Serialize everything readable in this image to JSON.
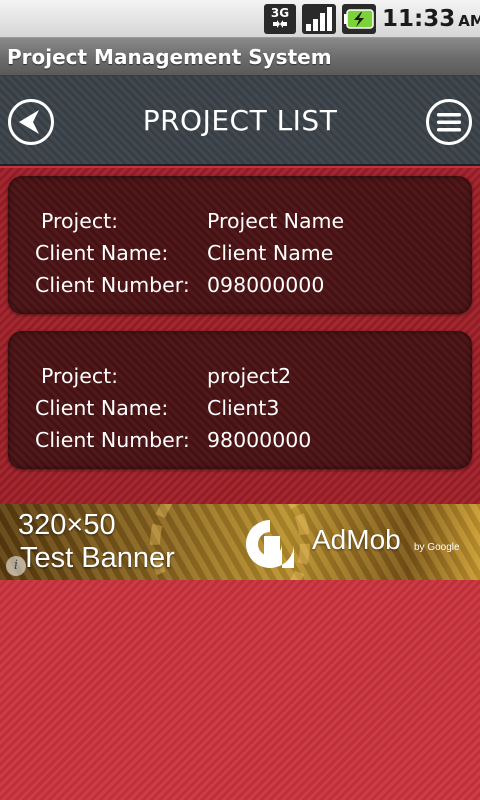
{
  "status_bar": {
    "network": "3G",
    "time": "11:33",
    "ampm": "AM",
    "icons": [
      "network-3g-icon",
      "signal-icon",
      "battery-charging-icon"
    ]
  },
  "app": {
    "title": "Project Management System"
  },
  "header": {
    "title": "PROJECT LIST",
    "left_icon": "back-arrow-icon",
    "right_icon": "menu-icon"
  },
  "projects": [
    {
      "project_label": "Project:",
      "project": "Project Name",
      "client_name_label": "Client Name:",
      "client_name": "Client Name",
      "client_number_label": "Client Number:",
      "client_number": "098000000"
    },
    {
      "project_label": "Project:",
      "project": "project2",
      "client_name_label": "Client Name:",
      "client_name": "Client3",
      "client_number_label": "Client Number:",
      "client_number": "98000000"
    }
  ],
  "ad": {
    "line1": "320×50",
    "line2": "Test Banner",
    "brand": "AdMob",
    "by": "by Google",
    "info": "i"
  },
  "colors": {
    "background": "#c8323c",
    "list_background": "#9d1e26",
    "card": "#4a1214",
    "header": "#3a4148",
    "title_bar": "#6b6b6b"
  }
}
